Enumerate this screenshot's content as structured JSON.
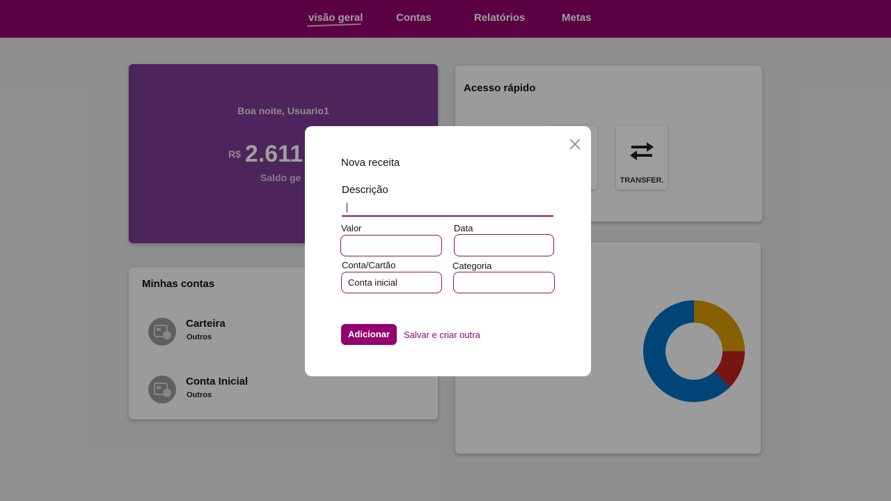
{
  "nav": {
    "items": [
      {
        "label": "visão geral"
      },
      {
        "label": "Contas"
      },
      {
        "label": "Relatórios"
      },
      {
        "label": "Metas"
      }
    ]
  },
  "balance": {
    "greeting": "Boa noite, Usuario1",
    "currency": "R$",
    "amount": "2.611",
    "label": "Saldo ge"
  },
  "quick_access": {
    "title": "Acesso rápido",
    "transfer_label": "TRANSFER."
  },
  "accounts": {
    "title": "Minhas contas",
    "items": [
      {
        "name": "Carteira",
        "type": "Outros"
      },
      {
        "name": "Conta Inicial",
        "type": "Outros"
      }
    ]
  },
  "donut_chart": {
    "segments": [
      {
        "color": "#d89a00",
        "fraction": 0.25
      },
      {
        "color": "#c0231c",
        "fraction": 0.125
      },
      {
        "color": "#0070c0",
        "fraction": 0.625
      }
    ]
  },
  "modal": {
    "title": "Nova receita",
    "description_label": "Descrição",
    "description_value": "",
    "valor_label": "Valor",
    "data_label": "Data",
    "conta_label": "Conta/Cartão",
    "conta_value": "Conta inicial",
    "categoria_label": "Categoria",
    "add_button": "Adicionar",
    "save_new_link": "Salvar e criar outra"
  },
  "colors": {
    "brand": "#95006e",
    "balance_card": "#7e3a95"
  }
}
